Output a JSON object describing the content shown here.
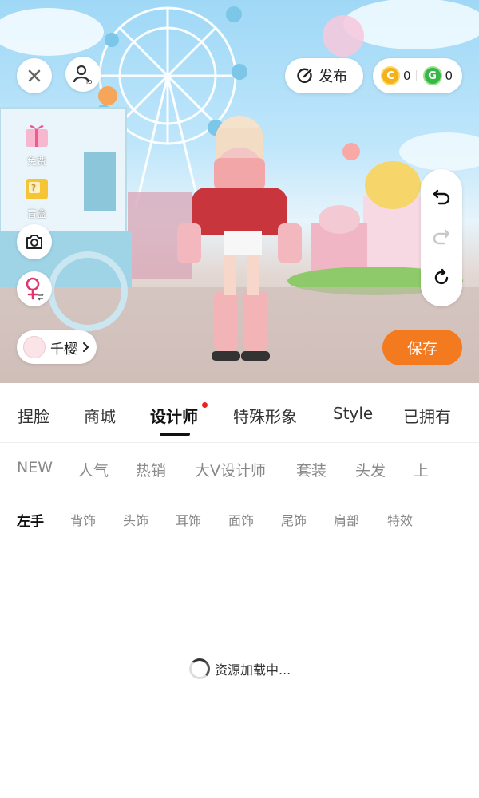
{
  "top": {
    "publish_label": "发布",
    "coin_gold": "0",
    "coin_green": "0"
  },
  "side": {
    "free_label": "免费",
    "blindbox_label": "盲盒"
  },
  "character": {
    "name": "千樱"
  },
  "save_label": "保存",
  "main_tabs": [
    "捏脸",
    "商城",
    "设计师",
    "特殊形象",
    "Style",
    "已拥有"
  ],
  "sub_tabs": [
    "NEW",
    "人气",
    "热销",
    "大V设计师",
    "套装",
    "头发",
    "上"
  ],
  "categories": [
    "左手",
    "背饰",
    "头饰",
    "耳饰",
    "面饰",
    "尾饰",
    "肩部",
    "特效"
  ],
  "loading_text": "资源加载中..."
}
